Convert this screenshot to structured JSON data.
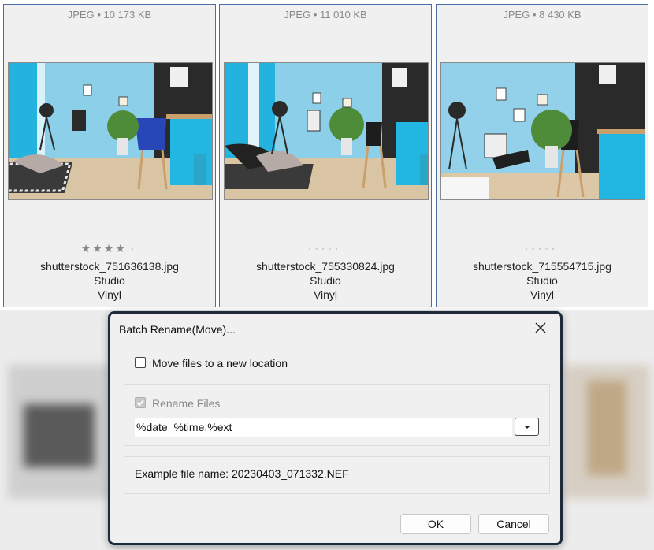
{
  "cards": [
    {
      "meta": "JPEG • 10 173 KB",
      "rating_filled": "★★★★",
      "rating_empty": "▫",
      "filename": "shutterstock_751636138.jpg",
      "tag1": "Studio",
      "tag2": "Vinyl"
    },
    {
      "meta": "JPEG • 11 010 KB",
      "rating_filled": "",
      "rating_empty": "▫▫▫▫▫",
      "filename": "shutterstock_755330824.jpg",
      "tag1": "Studio",
      "tag2": "Vinyl"
    },
    {
      "meta": "JPEG • 8 430 KB",
      "rating_filled": "",
      "rating_empty": "▫▫▫▫▫",
      "filename": "shutterstock_715554715.jpg",
      "tag1": "Studio",
      "tag2": "Vinyl"
    }
  ],
  "dialog": {
    "title": "Batch Rename(Move)...",
    "close_icon": "close-icon",
    "move_files_label": "Move files to a new location",
    "move_files_checked": false,
    "rename_files_label": "Rename Files",
    "rename_files_checked": true,
    "pattern_value": "%date_%time.%ext",
    "dropdown_icon": "chevron-down-icon",
    "example_text": "Example file name: 20230403_071332.NEF",
    "ok_label": "OK",
    "cancel_label": "Cancel"
  },
  "colors": {
    "accent_border": "#4a6fa5",
    "dialog_border": "#1f2a3a",
    "wall_blue": "#7fc7e6",
    "cyan_accent": "#1fb6e0"
  }
}
